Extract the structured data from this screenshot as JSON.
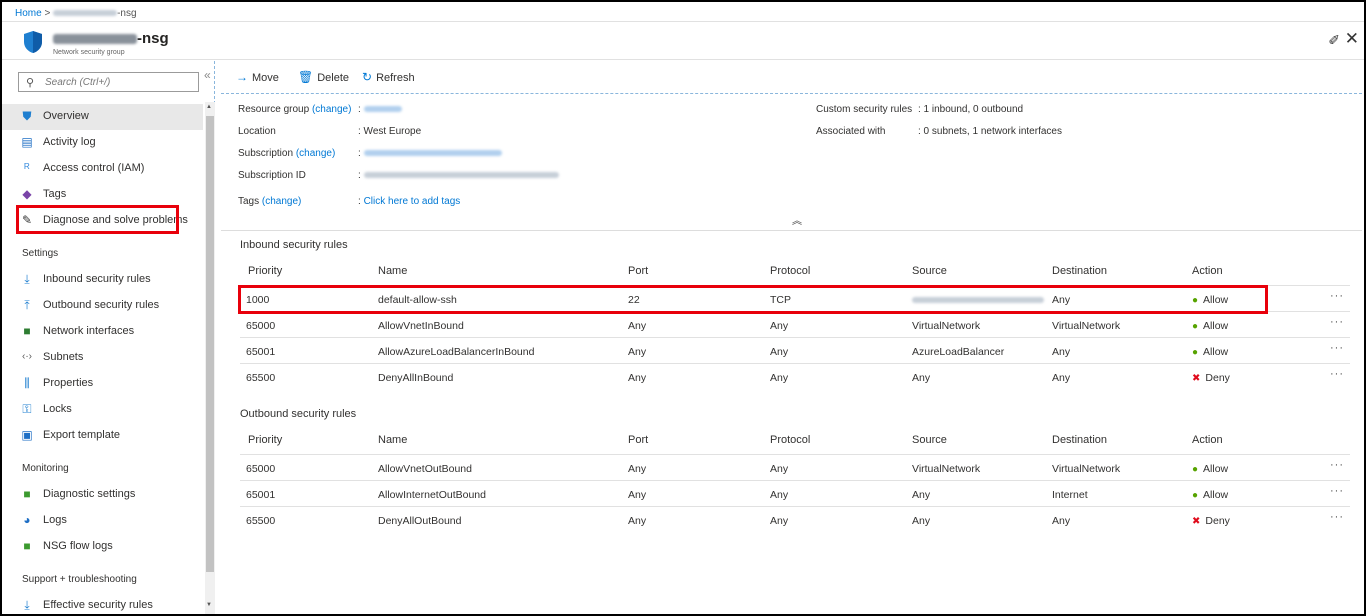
{
  "breadcrumb": {
    "home": "Home",
    "separator": ">",
    "suffix": "-nsg"
  },
  "resource": {
    "title_suffix": "-nsg",
    "type": "Network security group"
  },
  "window": {
    "pin_icon": "pin-icon",
    "close_icon": "close-icon"
  },
  "sidebar": {
    "search_placeholder": "Search (Ctrl+/)",
    "items": [
      {
        "label": "Overview",
        "icon": "shield-icon"
      },
      {
        "label": "Activity log",
        "icon": "activity-log-icon"
      },
      {
        "label": "Access control (IAM)",
        "icon": "people-icon"
      },
      {
        "label": "Tags",
        "icon": "tag-icon"
      },
      {
        "label": "Diagnose and solve problems",
        "icon": "wrench-icon"
      }
    ],
    "settings_header": "Settings",
    "settings_items": [
      {
        "label": "Inbound security rules",
        "icon": "inbound-icon"
      },
      {
        "label": "Outbound security rules",
        "icon": "outbound-icon"
      },
      {
        "label": "Network interfaces",
        "icon": "nic-icon"
      },
      {
        "label": "Subnets",
        "icon": "subnet-icon"
      },
      {
        "label": "Properties",
        "icon": "properties-icon"
      },
      {
        "label": "Locks",
        "icon": "lock-icon"
      },
      {
        "label": "Export template",
        "icon": "export-icon"
      }
    ],
    "monitoring_header": "Monitoring",
    "monitoring_items": [
      {
        "label": "Diagnostic settings",
        "icon": "diagnostic-icon"
      },
      {
        "label": "Logs",
        "icon": "logs-icon"
      },
      {
        "label": "NSG flow logs",
        "icon": "flowlogs-icon"
      }
    ],
    "support_header": "Support + troubleshooting",
    "support_items": [
      {
        "label": "Effective security rules",
        "icon": "effective-rules-icon"
      }
    ]
  },
  "toolbar": {
    "move": "Move",
    "delete": "Delete",
    "refresh": "Refresh"
  },
  "essentials": {
    "resource_group_label": "Resource group",
    "change": "(change)",
    "colon": ":",
    "location_label": "Location",
    "location_value": ": West Europe",
    "subscription_label": "Subscription",
    "subscription_id_label": "Subscription ID",
    "tags_label": "Tags",
    "tags_value": "Click here to add tags",
    "custom_rules_label": "Custom security rules",
    "custom_rules_value": ": 1 inbound, 0 outbound",
    "associated_label": "Associated with",
    "associated_value": ": 0 subnets, 1 network interfaces"
  },
  "columns": [
    "Priority",
    "Name",
    "Port",
    "Protocol",
    "Source",
    "Destination",
    "Action"
  ],
  "inbound": {
    "title": "Inbound security rules",
    "rows": [
      {
        "priority": "1000",
        "name": "default-allow-ssh",
        "port": "22",
        "protocol": "TCP",
        "source": "",
        "destination": "Any",
        "action": "Allow"
      },
      {
        "priority": "65000",
        "name": "AllowVnetInBound",
        "port": "Any",
        "protocol": "Any",
        "source": "VirtualNetwork",
        "destination": "VirtualNetwork",
        "action": "Allow"
      },
      {
        "priority": "65001",
        "name": "AllowAzureLoadBalancerInBound",
        "port": "Any",
        "protocol": "Any",
        "source": "AzureLoadBalancer",
        "destination": "Any",
        "action": "Allow"
      },
      {
        "priority": "65500",
        "name": "DenyAllInBound",
        "port": "Any",
        "protocol": "Any",
        "source": "Any",
        "destination": "Any",
        "action": "Deny"
      }
    ]
  },
  "outbound": {
    "title": "Outbound security rules",
    "rows": [
      {
        "priority": "65000",
        "name": "AllowVnetOutBound",
        "port": "Any",
        "protocol": "Any",
        "source": "VirtualNetwork",
        "destination": "VirtualNetwork",
        "action": "Allow"
      },
      {
        "priority": "65001",
        "name": "AllowInternetOutBound",
        "port": "Any",
        "protocol": "Any",
        "source": "Any",
        "destination": "Internet",
        "action": "Allow"
      },
      {
        "priority": "65500",
        "name": "DenyAllOutBound",
        "port": "Any",
        "protocol": "Any",
        "source": "Any",
        "destination": "Any",
        "action": "Deny"
      }
    ]
  },
  "more_label": "···",
  "colors": {
    "accent": "#0078d4",
    "allow": "#57a300",
    "deny": "#e00b1c",
    "highlight": "#e8000b"
  }
}
